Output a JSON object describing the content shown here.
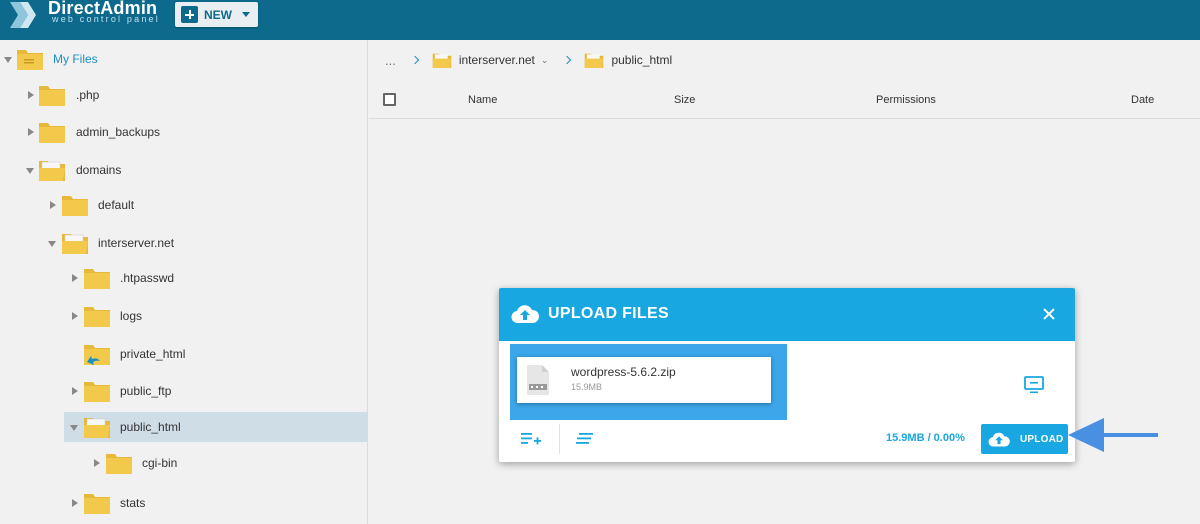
{
  "app": {
    "logo_title": "DirectAdmin",
    "logo_subtitle": "web control panel",
    "new_button_label": "NEW",
    "brand_color": "#0d6a8d",
    "accent_color": "#18a7e0"
  },
  "tree": {
    "items": [
      {
        "label": "My Files",
        "expanded": true,
        "icon": "folder-icon"
      },
      {
        "label": ".php",
        "expanded": false,
        "icon": "folder-icon"
      },
      {
        "label": "admin_backups",
        "expanded": false,
        "icon": "folder-icon"
      },
      {
        "label": "domains",
        "expanded": true,
        "icon": "folder-open-icon"
      },
      {
        "label": "default",
        "expanded": false,
        "icon": "folder-icon"
      },
      {
        "label": "interserver.net",
        "expanded": true,
        "icon": "folder-open-icon"
      },
      {
        "label": ".htpasswd",
        "expanded": false,
        "icon": "folder-icon"
      },
      {
        "label": "logs",
        "expanded": false,
        "icon": "folder-icon"
      },
      {
        "label": "private_html",
        "expanded": false,
        "icon": "folder-link-icon"
      },
      {
        "label": "public_ftp",
        "expanded": false,
        "icon": "folder-icon"
      },
      {
        "label": "public_html",
        "expanded": true,
        "selected": true,
        "icon": "folder-open-icon"
      },
      {
        "label": "cgi-bin",
        "expanded": false,
        "icon": "folder-icon"
      },
      {
        "label": "stats",
        "expanded": false,
        "icon": "folder-icon"
      }
    ]
  },
  "breadcrumb": {
    "ellipsis": "...",
    "items": [
      {
        "label": "interserver.net",
        "has_dropdown": true
      },
      {
        "label": "public_html",
        "has_dropdown": false
      }
    ]
  },
  "table": {
    "columns": [
      "Name",
      "Size",
      "Permissions",
      "Date"
    ]
  },
  "upload_dialog": {
    "title": "UPLOAD FILES",
    "file": {
      "name": "wordpress-5.6.2.zip",
      "size": "15.9MB"
    },
    "progress_text": "15.9MB / 0.00%",
    "upload_button_label": "UPLOAD"
  }
}
